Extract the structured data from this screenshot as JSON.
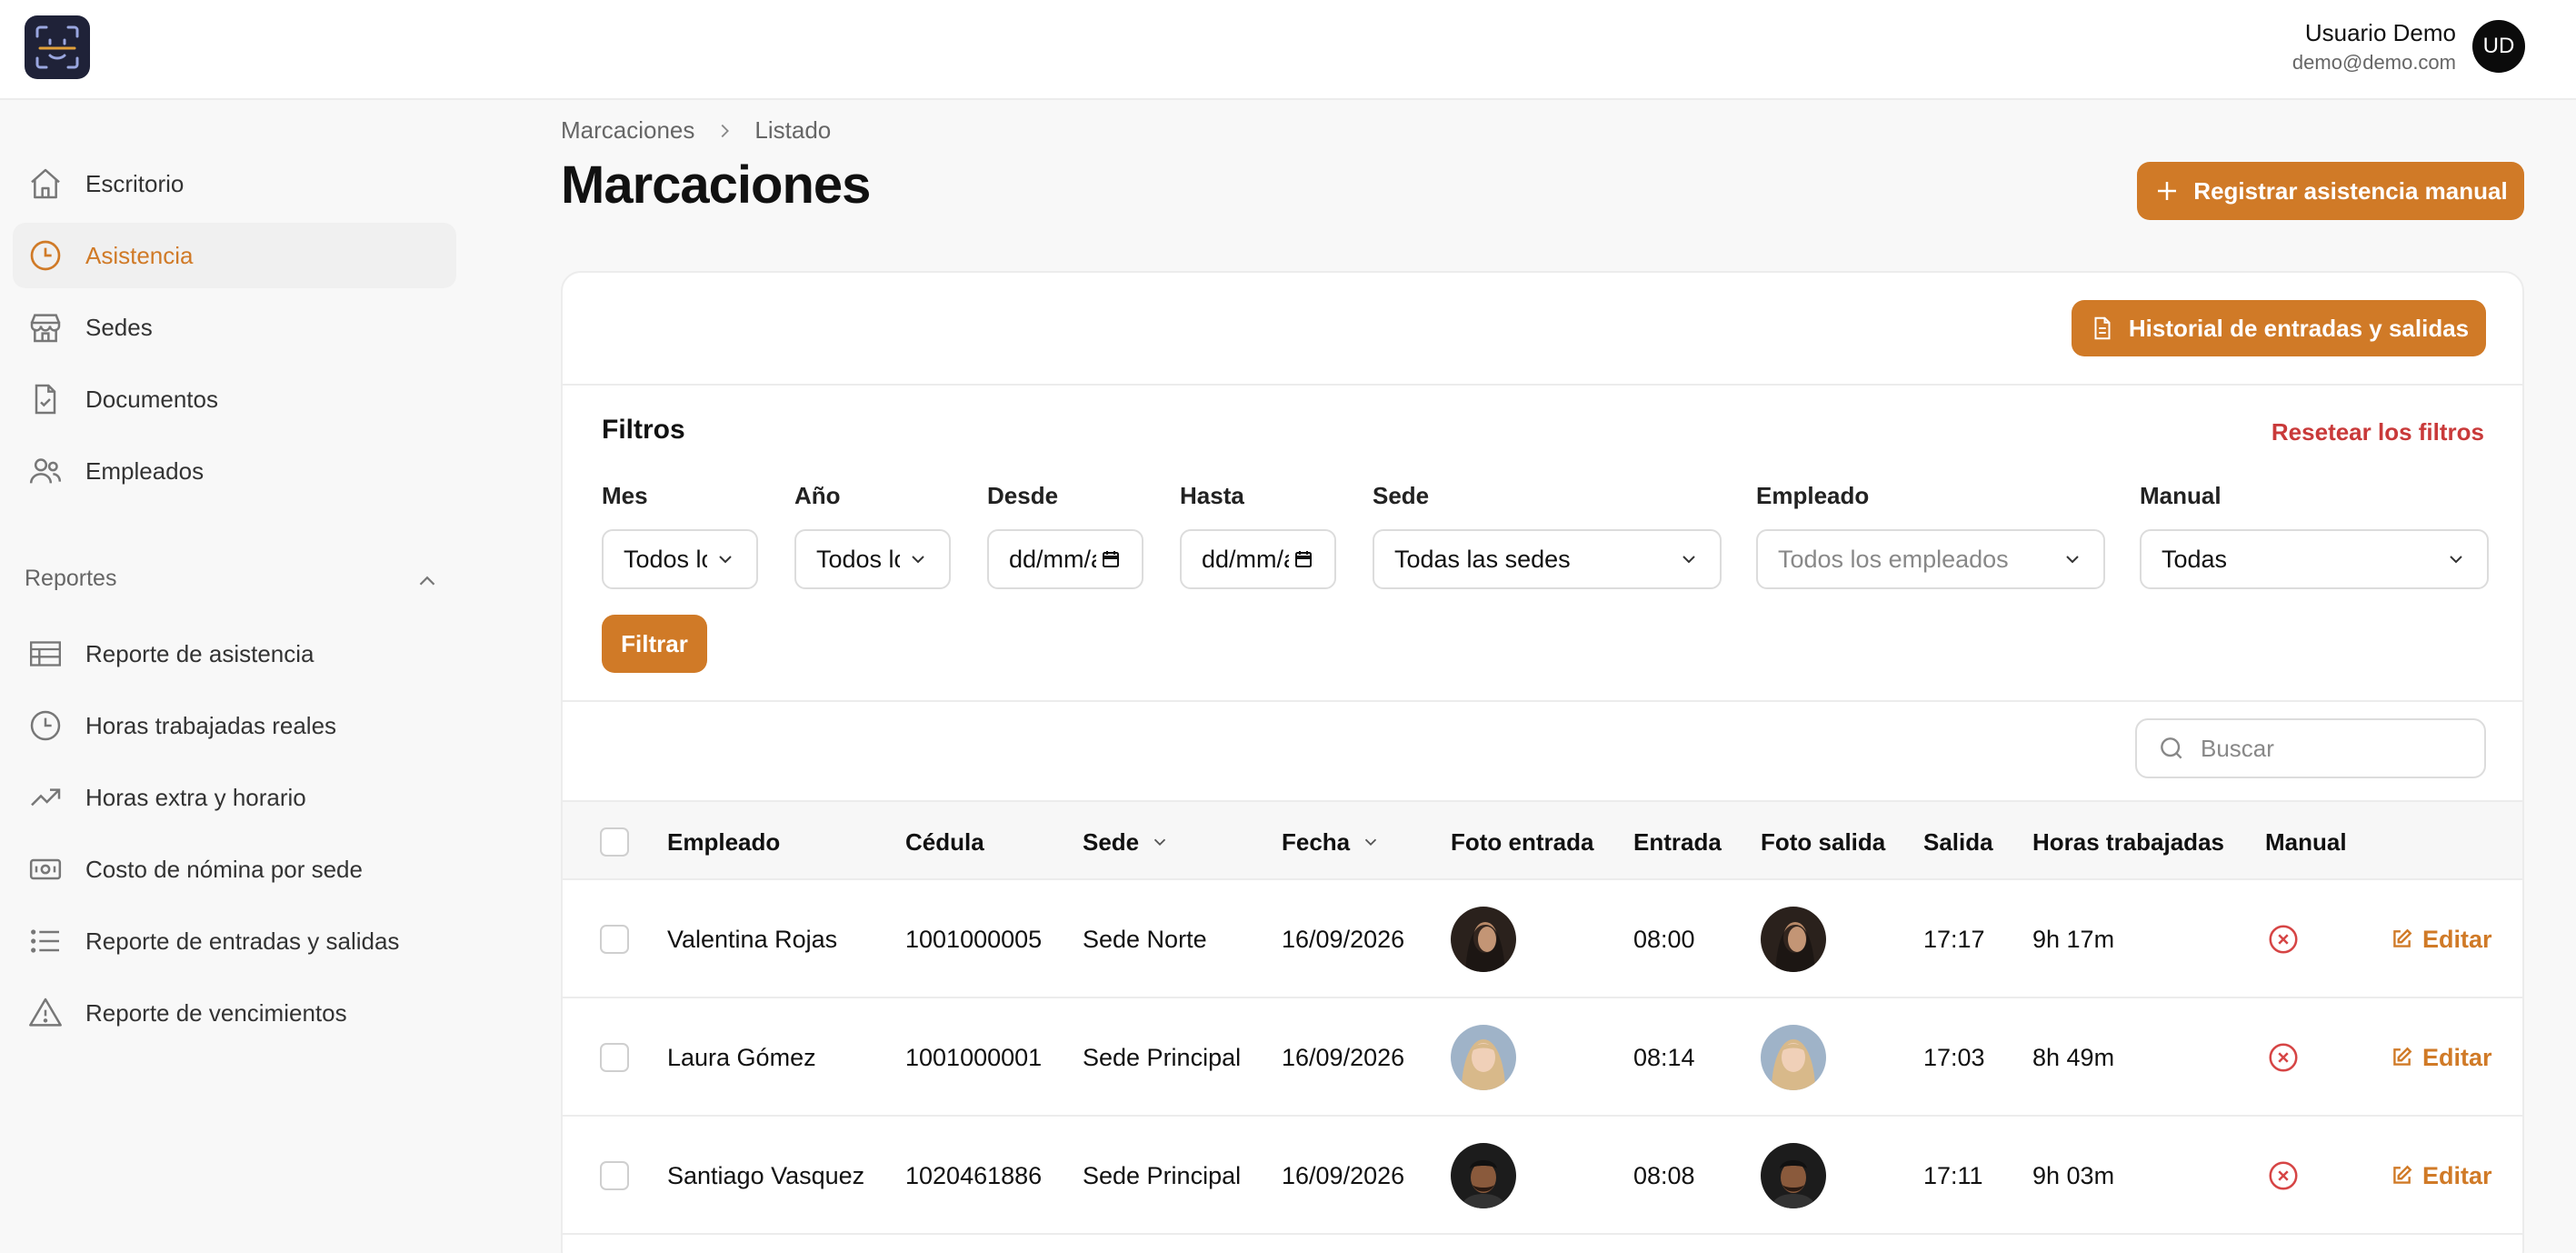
{
  "header": {
    "user_name": "Usuario Demo",
    "user_email": "demo@demo.com",
    "user_initials": "UD"
  },
  "sidebar": {
    "items": [
      {
        "label": "Escritorio",
        "icon": "home-icon",
        "active": false
      },
      {
        "label": "Asistencia",
        "icon": "clock-icon",
        "active": true
      },
      {
        "label": "Sedes",
        "icon": "store-icon",
        "active": false
      },
      {
        "label": "Documentos",
        "icon": "document-check-icon",
        "active": false
      },
      {
        "label": "Empleados",
        "icon": "users-icon",
        "active": false
      }
    ],
    "section_label": "Reportes",
    "reports": [
      {
        "label": "Reporte de asistencia",
        "icon": "table-icon"
      },
      {
        "label": "Horas trabajadas reales",
        "icon": "clock-icon"
      },
      {
        "label": "Horas extra y horario",
        "icon": "trending-up-icon"
      },
      {
        "label": "Costo de nómina por sede",
        "icon": "banknote-icon"
      },
      {
        "label": "Reporte de entradas y salidas",
        "icon": "list-icon"
      },
      {
        "label": "Reporte de vencimientos",
        "icon": "warning-icon"
      }
    ]
  },
  "breadcrumb": {
    "parent": "Marcaciones",
    "current": "Listado"
  },
  "page": {
    "title": "Marcaciones",
    "register_button": "Registrar asistencia manual",
    "history_button": "Historial de entradas y salidas"
  },
  "filters": {
    "title": "Filtros",
    "reset": "Resetear los filtros",
    "mes_label": "Mes",
    "mes_value": "Todos los meses",
    "anio_label": "Año",
    "anio_value": "Todos los años",
    "desde_label": "Desde",
    "desde_value": "dd/mm/aaaa",
    "hasta_label": "Hasta",
    "hasta_value": "dd/mm/aaaa",
    "sede_label": "Sede",
    "sede_value": "Todas las sedes",
    "empleado_label": "Empleado",
    "empleado_placeholder": "Todos los empleados",
    "manual_label": "Manual",
    "manual_value": "Todas",
    "filter_button": "Filtrar"
  },
  "search": {
    "placeholder": "Buscar"
  },
  "table": {
    "columns": {
      "empleado": "Empleado",
      "cedula": "Cédula",
      "sede": "Sede",
      "fecha": "Fecha",
      "foto_entrada": "Foto entrada",
      "entrada": "Entrada",
      "foto_salida": "Foto salida",
      "salida": "Salida",
      "horas": "Horas trabajadas",
      "manual": "Manual"
    },
    "edit_label": "Editar",
    "rows": [
      {
        "empleado": "Valentina Rojas",
        "cedula": "1001000005",
        "sede": "Sede Norte",
        "fecha": "16/09/2026",
        "entrada": "08:00",
        "salida": "17:17",
        "horas": "9h 17m",
        "manual": false
      },
      {
        "empleado": "Laura Gómez",
        "cedula": "1001000001",
        "sede": "Sede Principal",
        "fecha": "16/09/2026",
        "entrada": "08:14",
        "salida": "17:03",
        "horas": "8h 49m",
        "manual": false
      },
      {
        "empleado": "Santiago Vasquez",
        "cedula": "1020461886",
        "sede": "Sede Principal",
        "fecha": "16/09/2026",
        "entrada": "08:08",
        "salida": "17:11",
        "horas": "9h 03m",
        "manual": false
      }
    ]
  },
  "colors": {
    "accent": "#d07a27",
    "danger": "#c93a3a",
    "logo_bg": "#1f2238"
  }
}
